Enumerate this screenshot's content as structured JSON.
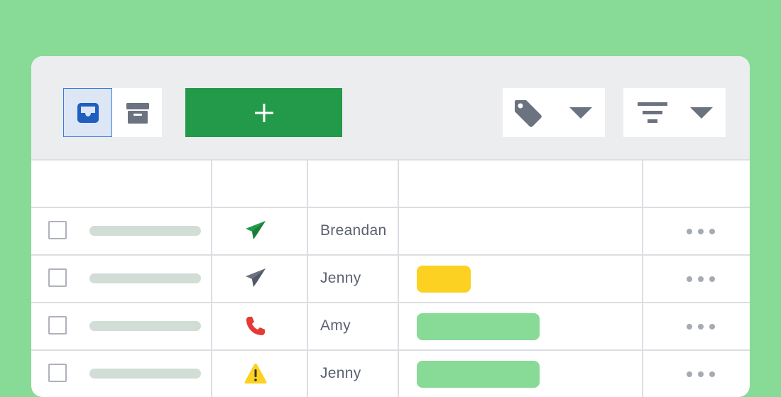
{
  "toolbar": {
    "view_buttons": [
      {
        "name": "inbox-view",
        "icon": "inbox-icon",
        "selected": true
      },
      {
        "name": "archive-view",
        "icon": "archive-box-icon",
        "selected": false
      }
    ],
    "add_button": {
      "icon": "plus-icon",
      "color": "#229a4a"
    },
    "tag_dropdown": {
      "icon": "tag-icon"
    },
    "filter_dropdown": {
      "icon": "filter-icon"
    }
  },
  "colors": {
    "background": "#88da97",
    "accent_green": "#229a4a",
    "selected_blue": "#3a7bdc",
    "yellow_label": "#fdd121",
    "green_label": "#88da97"
  },
  "rows": [
    {
      "status_icon": "sent-icon",
      "status_color": "#229a4a",
      "name": "Breandan",
      "label": null
    },
    {
      "status_icon": "sent-icon",
      "status_color": "#6b7280",
      "name": "Jenny",
      "label": {
        "color": "#fdd121",
        "size": "short"
      }
    },
    {
      "status_icon": "phone-icon",
      "status_color": "#e53935",
      "name": "Amy",
      "label": {
        "color": "#88da97",
        "size": "long"
      }
    },
    {
      "status_icon": "warning-icon",
      "status_color": "#fdd121",
      "name": "Jenny",
      "label": {
        "color": "#88da97",
        "size": "long"
      }
    }
  ]
}
